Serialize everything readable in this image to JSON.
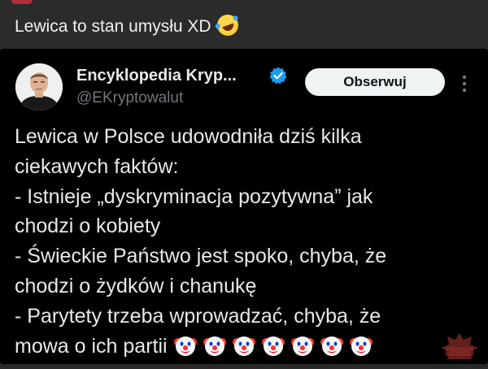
{
  "post": {
    "caption": "Lewica to stan umysłu XD",
    "caption_emoji": "rolling-on-floor-laughing-emoji"
  },
  "tweet": {
    "author_name": "Encyklopedia Kryp...",
    "handle": "@EKryptowalut",
    "follow_label": "Obserwuj",
    "verified_color": "#1d9bf0",
    "lines": [
      "Lewica w Polsce udowodniła dziś kilka",
      "ciekawych faktów:",
      "- Istnieje „dyskryminacja pozytywna” jak",
      "chodzi o kobiety",
      "- Świeckie Państwo jest spoko, chyba, że",
      "chodzi o żydków i chanukę",
      "- Parytety trzeba wprowadzać, chyba, że"
    ],
    "last_line": "mowa o ich partii",
    "emoji_name": "clown-face-emoji",
    "emoji_count": 7
  },
  "watermark": {
    "text": "JBZD"
  },
  "colors": {
    "background": "#2a2a2a",
    "tweet_bg": "#000000",
    "text": "#e7e9ea",
    "muted": "#71767b",
    "accent": "#1d9bf0"
  }
}
